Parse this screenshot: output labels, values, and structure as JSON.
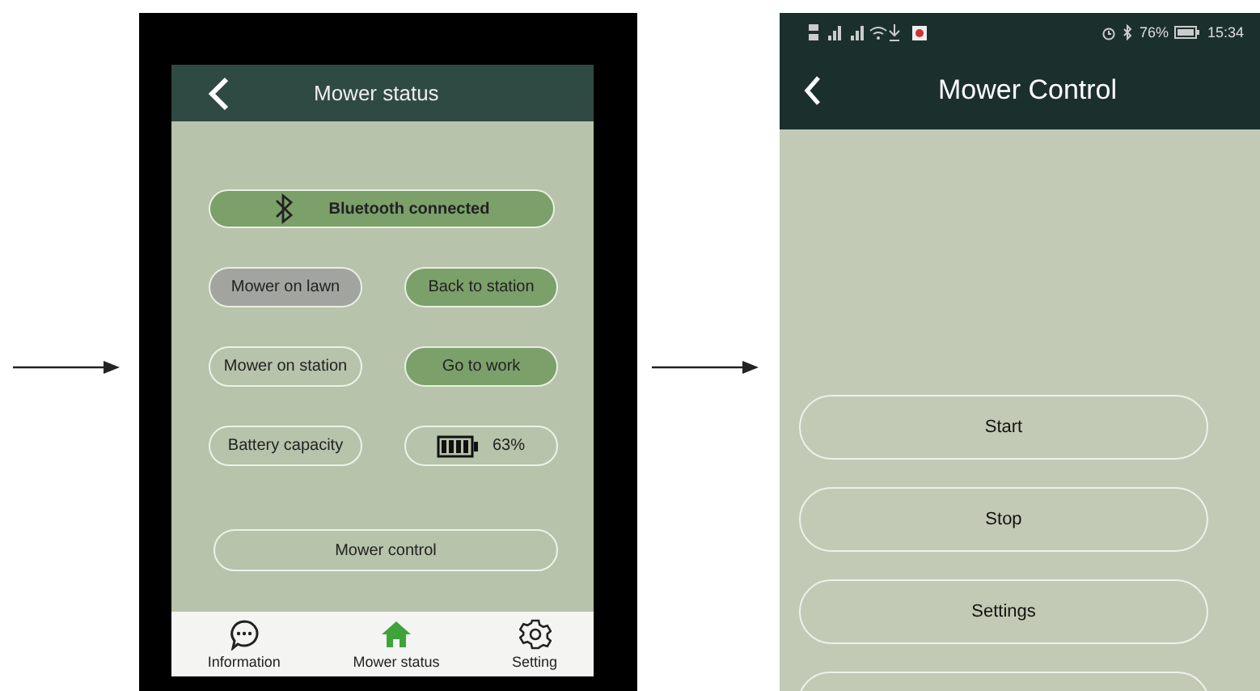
{
  "left_screen": {
    "title": "Mower status",
    "bluetooth": "Bluetooth connected",
    "status_rows": [
      {
        "label": "Mower on lawn",
        "selected": true,
        "kind": "action",
        "value": "Back to station"
      },
      {
        "label": "Mower on station",
        "selected": false,
        "kind": "action",
        "value": "Go to work"
      },
      {
        "label": "Battery capacity",
        "selected": false,
        "kind": "reading",
        "value": "63%"
      }
    ],
    "control_button": "Mower control",
    "tabs": [
      {
        "label": "Information",
        "kind": "chat",
        "selected": false
      },
      {
        "label": "Mower status",
        "kind": "home",
        "selected": true
      },
      {
        "label": "Setting",
        "kind": "gear",
        "selected": false
      }
    ]
  },
  "right_screen": {
    "status_bar": {
      "battery": "76%",
      "time": "15:34"
    },
    "title": "Mower Control",
    "buttons": [
      "Start",
      "Stop",
      "Settings"
    ]
  }
}
